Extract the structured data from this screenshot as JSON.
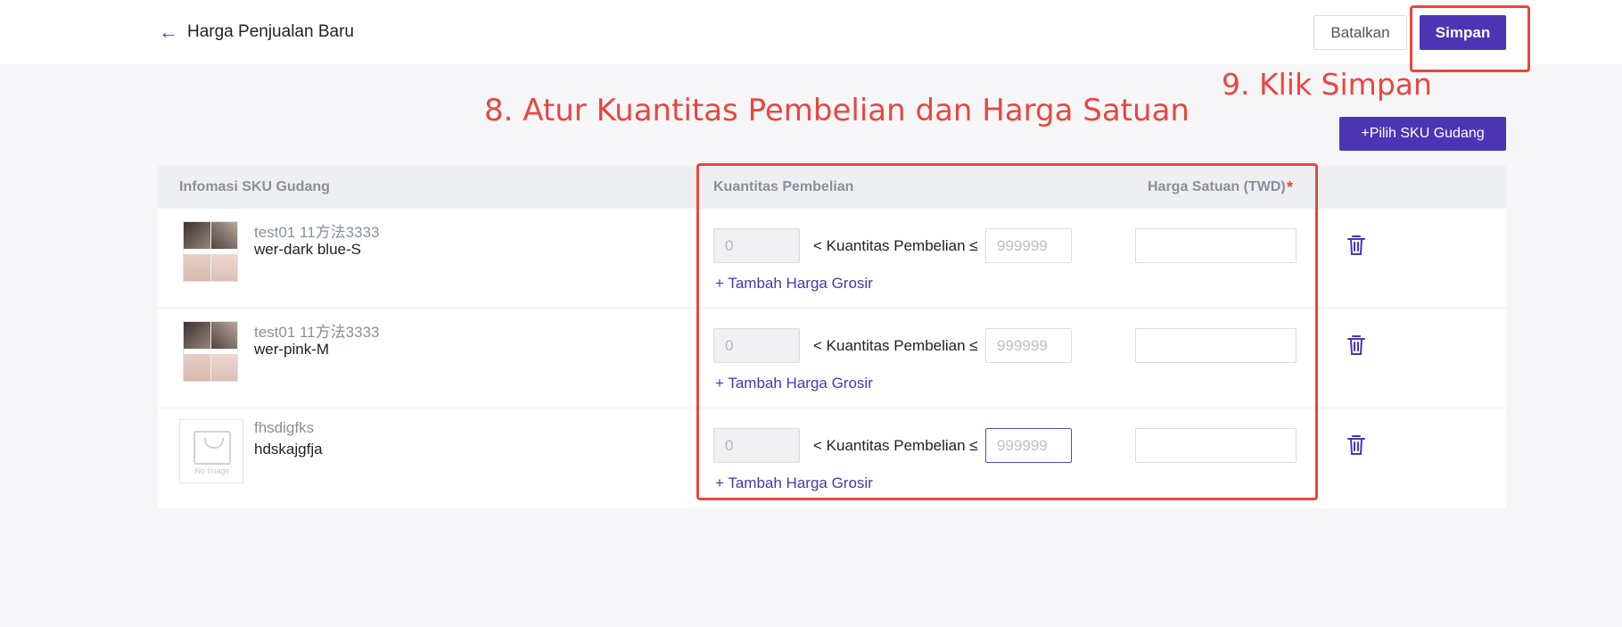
{
  "header": {
    "back_icon": "arrow-left-icon",
    "title": "Harga Penjualan Baru",
    "cancel_label": "Batalkan",
    "save_label": "Simpan"
  },
  "annotations": {
    "step9": "9. Klik Simpan",
    "step8": "8. Atur Kuantitas Pembelian dan Harga Satuan",
    "color": "#e8473f"
  },
  "toolbar": {
    "pick_sku_label": "+Pilih SKU Gudang"
  },
  "table": {
    "headers": {
      "info": "Infomasi SKU Gudang",
      "qty": "Kuantitas Pembelian",
      "price": "Harga Satuan (TWD)",
      "required": "*"
    },
    "between_label": "< Kuantitas Pembelian ≤",
    "add_tier_label": "+ Tambah Harga Grosir",
    "delete_icon": "trash-icon",
    "rows": [
      {
        "name": "test01 11方法3333",
        "variant": "wer-dark blue-S",
        "image": "product-thumbnail",
        "min_qty": "0",
        "max_qty_placeholder": "999999",
        "unit_price": ""
      },
      {
        "name": "test01 11方法3333",
        "variant": "wer-pink-M",
        "image": "product-thumbnail",
        "min_qty": "0",
        "max_qty_placeholder": "999999",
        "unit_price": ""
      },
      {
        "name": "fhsdigfks",
        "variant": "hdskajgfja",
        "image": "no-image-placeholder",
        "no_image_text": "No Image",
        "min_qty": "0",
        "max_qty_placeholder": "999999",
        "unit_price": ""
      }
    ]
  },
  "colors": {
    "primary": "#4b35b5",
    "highlight": "#e8473f",
    "background": "#f6f6f8"
  }
}
